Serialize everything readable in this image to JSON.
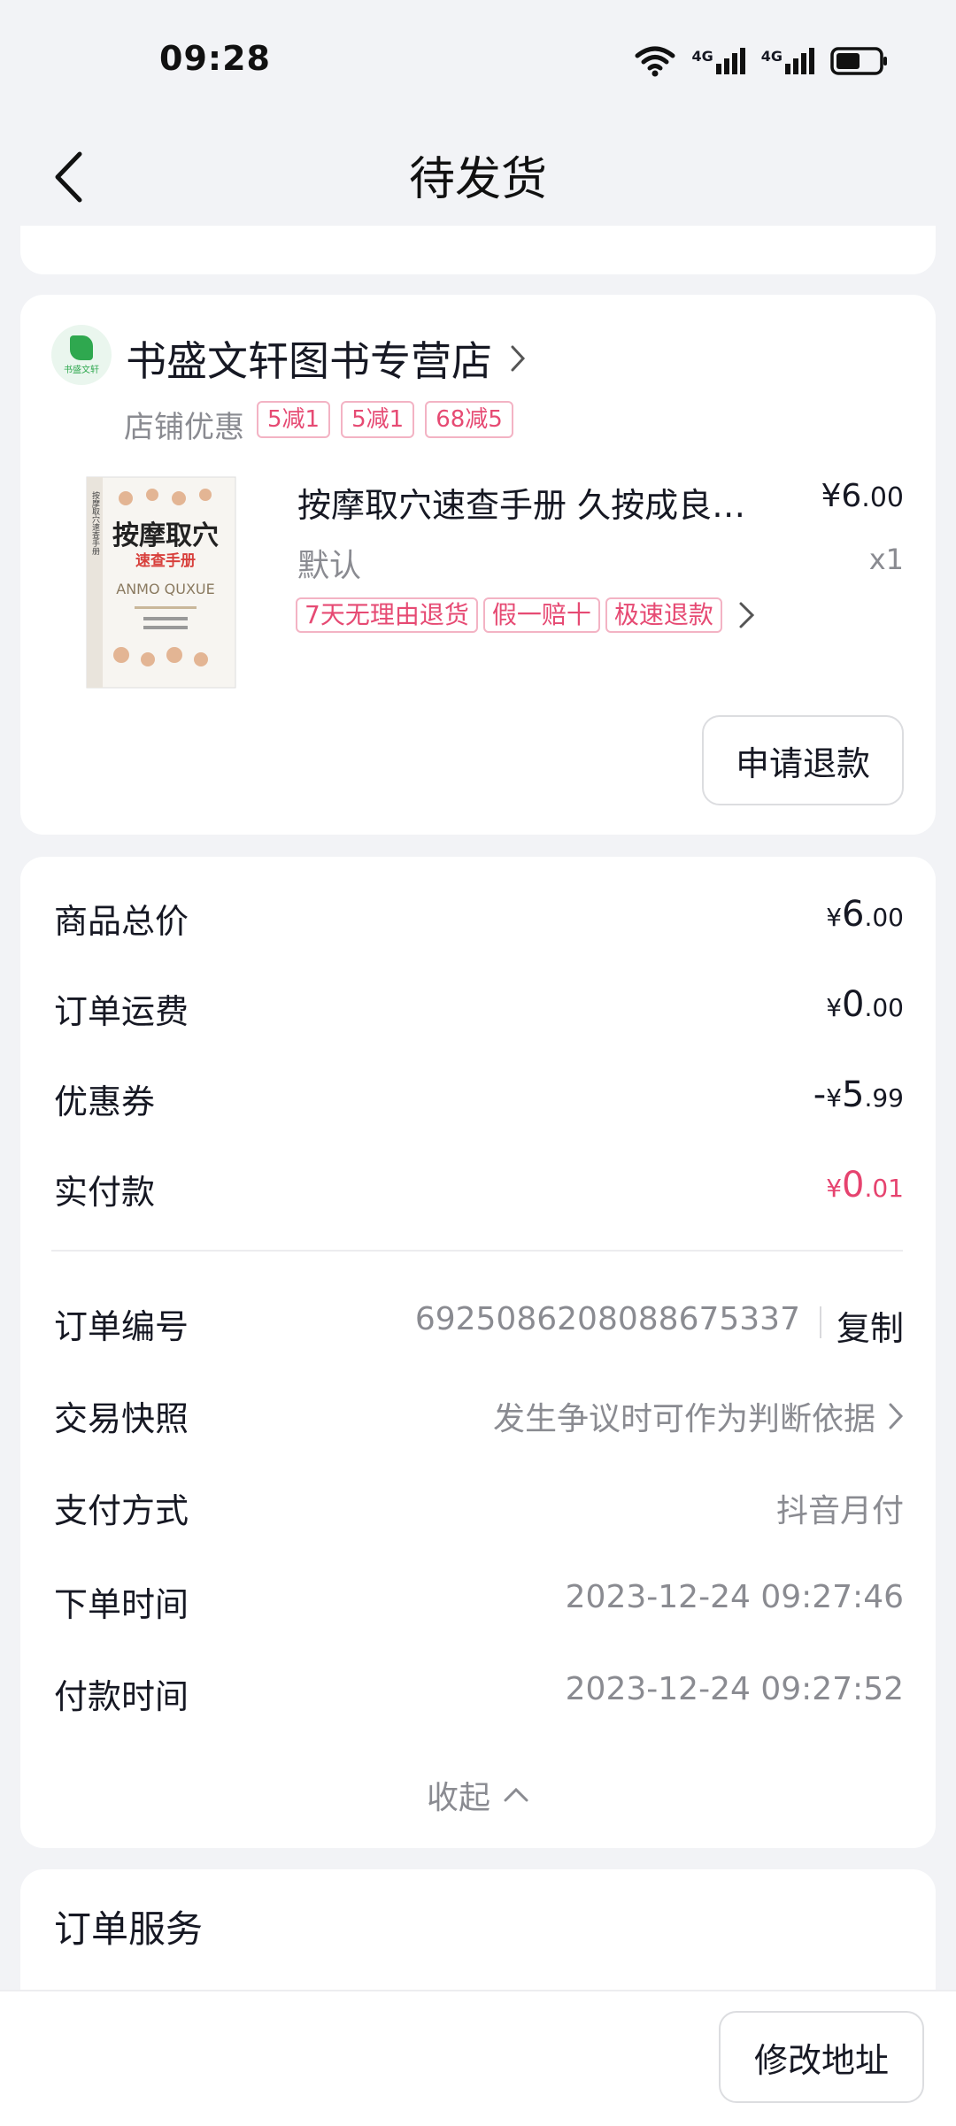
{
  "status_bar": {
    "time": "09:28",
    "network1": "4G",
    "network2": "4G"
  },
  "header": {
    "title": "待发货"
  },
  "store": {
    "logo_text": "书盛文轩",
    "name": "书盛文轩图书专营店",
    "promo_label": "店铺优惠",
    "promo_tags": [
      "5减1",
      "5减1",
      "68减5"
    ]
  },
  "product": {
    "title": "按摩取穴速查手册  久按成良医…",
    "price_currency": "¥",
    "price_int": "6",
    "price_dec": ".00",
    "spec": "默认",
    "quantity": "x1",
    "service_tags": [
      "7天无理由退货",
      "假一赔十",
      "极速退款"
    ],
    "cover": {
      "title": "按摩取穴",
      "subtitle": "速查手册",
      "pinyin": "ANMO QUXUE",
      "side": "按摩取穴速查手册"
    },
    "refund_button": "申请退款"
  },
  "order": {
    "goods_total": {
      "label": "商品总价",
      "prefix": "",
      "currency": "¥",
      "int": "6",
      "dec": ".00"
    },
    "shipping": {
      "label": "订单运费",
      "prefix": "",
      "currency": "¥",
      "int": "0",
      "dec": ".00"
    },
    "coupon": {
      "label": "优惠券",
      "prefix": "-",
      "currency": "¥",
      "int": "5",
      "dec": ".99"
    },
    "paid": {
      "label": "实付款",
      "prefix": "",
      "currency": "¥",
      "int": "0",
      "dec": ".01"
    },
    "order_no": {
      "label": "订单编号",
      "value": "6925086208088675337",
      "copy": "复制"
    },
    "snapshot": {
      "label": "交易快照",
      "value": "发生争议时可作为判断依据"
    },
    "payment_method": {
      "label": "支付方式",
      "value": "抖音月付"
    },
    "order_time": {
      "label": "下单时间",
      "value": "2023-12-24 09:27:46"
    },
    "pay_time": {
      "label": "付款时间",
      "value": "2023-12-24 09:27:52"
    },
    "collapse": "收起"
  },
  "service": {
    "title": "订单服务"
  },
  "bottom": {
    "modify_address": "修改地址"
  },
  "colors": {
    "accent_red": "#e6436f",
    "tag_border": "#f3b3c4",
    "logo_green": "#2fa84f"
  }
}
